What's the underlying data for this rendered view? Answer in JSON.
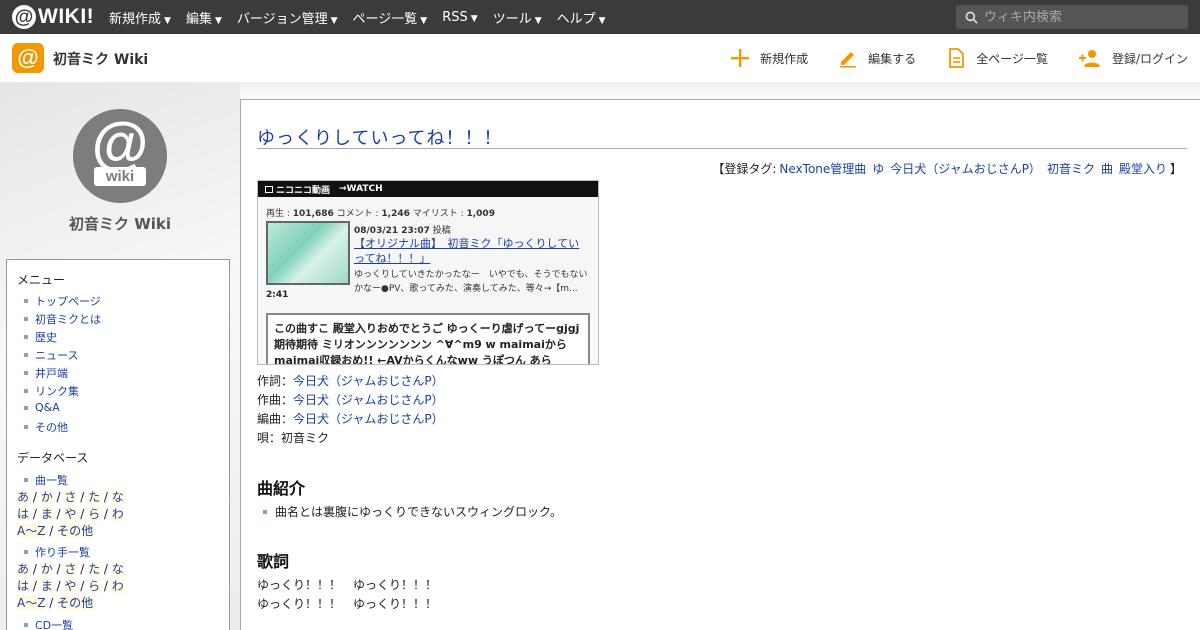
{
  "topbar": {
    "logo_at": "@",
    "logo_text": "WIKI!",
    "nav": [
      "新規作成",
      "編集",
      "バージョン管理",
      "ページ一覧",
      "RSS",
      "ツール",
      "ヘルプ"
    ],
    "search_placeholder": "ウィキ内検索"
  },
  "subbar": {
    "site_name": "初音ミク Wiki",
    "actions": {
      "new": "新規作成",
      "edit": "編集する",
      "all_pages": "全ページ一覧",
      "register": "登録/ログイン"
    }
  },
  "sidebar": {
    "logo_at": "@",
    "logo_wiki": "wiki",
    "title": "初音ミク Wiki",
    "menu_head": "メニュー",
    "menu": [
      "トップページ",
      "初音ミクとは",
      "歴史",
      "ニュース",
      "井戸端",
      "リンク集",
      "Q&A",
      "その他"
    ],
    "db_head": "データベース",
    "songs_label": "曲一覧",
    "creators_label": "作り手一覧",
    "cd_label": "CD一覧",
    "kana_rows": [
      [
        "あ",
        "か",
        "さ",
        "た",
        "な"
      ],
      [
        "は",
        "ま",
        "や",
        "ら",
        "わ"
      ],
      [
        "A～Z",
        "その他"
      ]
    ]
  },
  "page": {
    "title": "ゆっくりしていってね！！！",
    "tags_open": "【登録タグ:",
    "tags": [
      "NexTone管理曲",
      "ゆ",
      "今日犬（ジャムおじさんP）",
      "初音ミク",
      "曲",
      "殿堂入り"
    ],
    "tags_close": "】",
    "video": {
      "header_brand": "ニコニコ動画",
      "header_watch": "→WATCH",
      "plays_label": "再生 : ",
      "plays": "101,686",
      "comments_label": " コメント : ",
      "comments": "1,246",
      "mylist_label": " マイリスト : ",
      "mylist": "1,009",
      "duration": "2:41",
      "date": "08/03/21 23:07",
      "posted": " 投稿",
      "title": "【オリジナル曲】　初音ミク「ゆっくりしていってね！！！」",
      "desc": "ゆっくりしていきたかったなー　いやでも、そうでもないかなー●PV、歌ってみた、演奏してみた、等々→【m...",
      "comment_text": "この曲すこ 殿堂入りおめでとうご ゆっくーり虐げってーgjgj 期待期待 ミリオンンンンンンン ^∀^m9 w maimaiから maimai収録おめ!! ←AVからくんなww うぽつん あら"
    },
    "credits": [
      {
        "label": "作詞：",
        "value": "今日犬（ジャムおじさんP）"
      },
      {
        "label": "作曲：",
        "value": "今日犬（ジャムおじさんP）"
      },
      {
        "label": "編曲：",
        "value": "今日犬（ジャムおじさんP）"
      },
      {
        "label": "唄：",
        "value": "初音ミク"
      }
    ],
    "intro_heading": "曲紹介",
    "intro_text": "曲名とは裏腹にゆっくりできないスウィングロック。",
    "lyrics_heading": "歌詞",
    "lyrics": "ゆっくり！！！　ゆっくり！！！\nゆっくり！！！　ゆっくり！！！"
  },
  "colors": {
    "topbar": "#3b3b3b",
    "accent_orange": "#f39800",
    "link": "#1a3fa0"
  }
}
